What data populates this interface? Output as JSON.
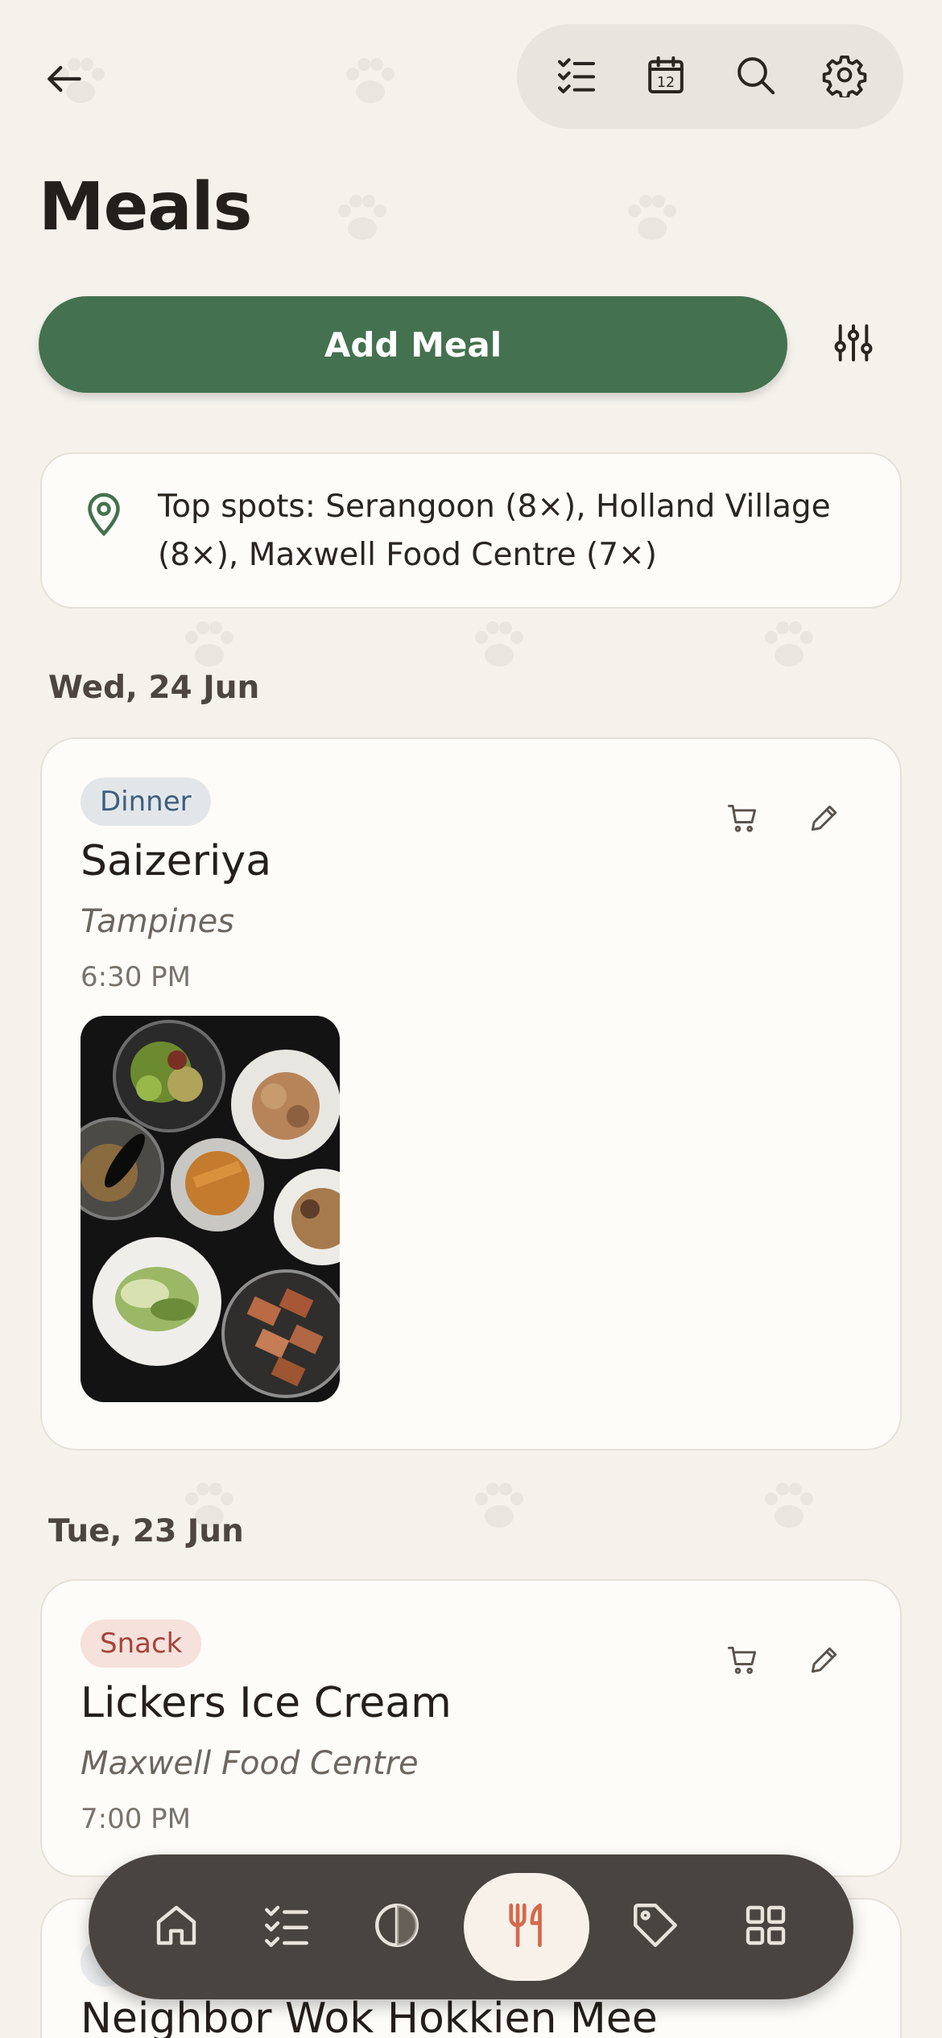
{
  "header": {
    "title": "Meals",
    "icons": [
      "back-arrow-icon",
      "checklist-icon",
      "calendar-icon",
      "search-icon",
      "gear-icon"
    ],
    "calendar_day": "12"
  },
  "actions": {
    "add_meal_label": "Add Meal"
  },
  "top_spots": {
    "text": "Top spots: Serangoon (8×), Holland Village (8×), Maxwell Food Centre (7×)"
  },
  "groups": [
    {
      "date": "Wed, 24 Jun",
      "meals": [
        {
          "type": "Dinner",
          "name": "Saizeriya",
          "location": "Tampines",
          "time": "6:30 PM",
          "has_photo": true
        }
      ]
    },
    {
      "date": "Tue, 23 Jun",
      "meals": [
        {
          "type": "Snack",
          "name": "Lickers Ice Cream",
          "location": "Maxwell Food Centre",
          "time": "7:00 PM",
          "has_photo": false
        },
        {
          "type": "",
          "name": "Neighbor Wok Hokkien Mee",
          "location": "",
          "time": "",
          "has_photo": false
        }
      ]
    }
  ],
  "bottom_nav": {
    "items": [
      "home-icon",
      "checklist-icon",
      "contrast-icon",
      "fork-knife-icon",
      "tag-icon",
      "grid-icon"
    ],
    "active": "fork-knife-icon"
  },
  "colors": {
    "background": "#f5f2ec",
    "primary_green": "#44714f",
    "dinner_badge_bg": "#e3e6e9",
    "dinner_badge_text": "#3d5f80",
    "snack_badge_bg": "#f6e1dc",
    "snack_badge_text": "#a4443b",
    "nav_bg": "#4a4440",
    "nav_active": "#d4694b"
  }
}
